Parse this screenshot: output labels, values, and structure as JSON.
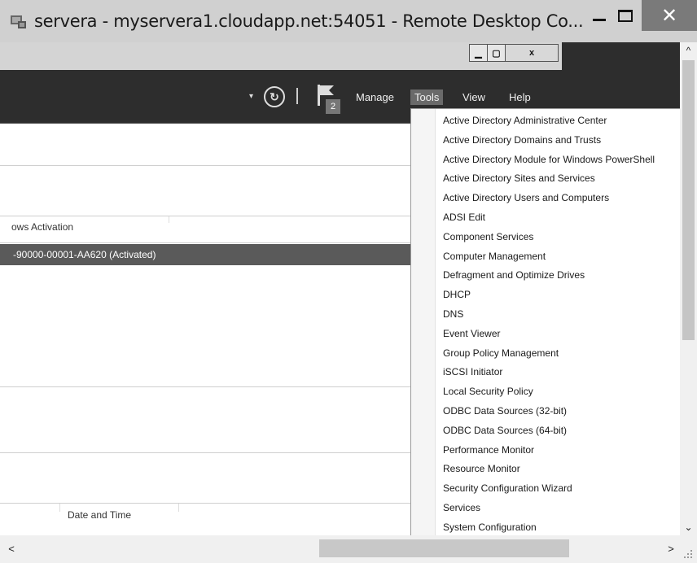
{
  "rdp_window": {
    "title": "servera - myservera1.cloudapp.net:54051 - Remote Desktop Co...",
    "min_icon": "minimize-icon",
    "max_icon": "maximize-icon",
    "close_glyph": "✕"
  },
  "inner_window": {
    "min_glyph": "▁",
    "max_glyph": "▢",
    "close_glyph": "x"
  },
  "header": {
    "dropdown_glyph": "▾",
    "refresh_glyph": "↻",
    "notification_count": "2",
    "menus": [
      {
        "label": "Manage",
        "active": false
      },
      {
        "label": "Tools",
        "active": true
      },
      {
        "label": "View",
        "active": false
      },
      {
        "label": "Help",
        "active": false
      }
    ]
  },
  "content": {
    "column_header": "ows Activation",
    "selected_row": "-90000-00001-AA620 (Activated)",
    "date_time_header": "Date and Time"
  },
  "tools_menu": {
    "items": [
      "Active Directory Administrative Center",
      "Active Directory Domains and Trusts",
      "Active Directory Module for Windows PowerShell",
      "Active Directory Sites and Services",
      "Active Directory Users and Computers",
      "ADSI Edit",
      "Component Services",
      "Computer Management",
      "Defragment and Optimize Drives",
      "DHCP",
      "DNS",
      "Event Viewer",
      "Group Policy Management",
      "iSCSI Initiator",
      "Local Security Policy",
      "ODBC Data Sources (32-bit)",
      "ODBC Data Sources (64-bit)",
      "Performance Monitor",
      "Resource Monitor",
      "Security Configuration Wizard",
      "Services",
      "System Configuration"
    ]
  },
  "scrollbars": {
    "up_glyph": "^",
    "down_glyph": "⌄",
    "left_glyph": "<",
    "right_glyph": ">"
  },
  "colors": {
    "header_bg": "#2d2d2d",
    "menu_active_bg": "#6a6a6a",
    "selected_row_bg": "#5a5a5a",
    "rdp_close_bg": "#7a7a7a"
  }
}
